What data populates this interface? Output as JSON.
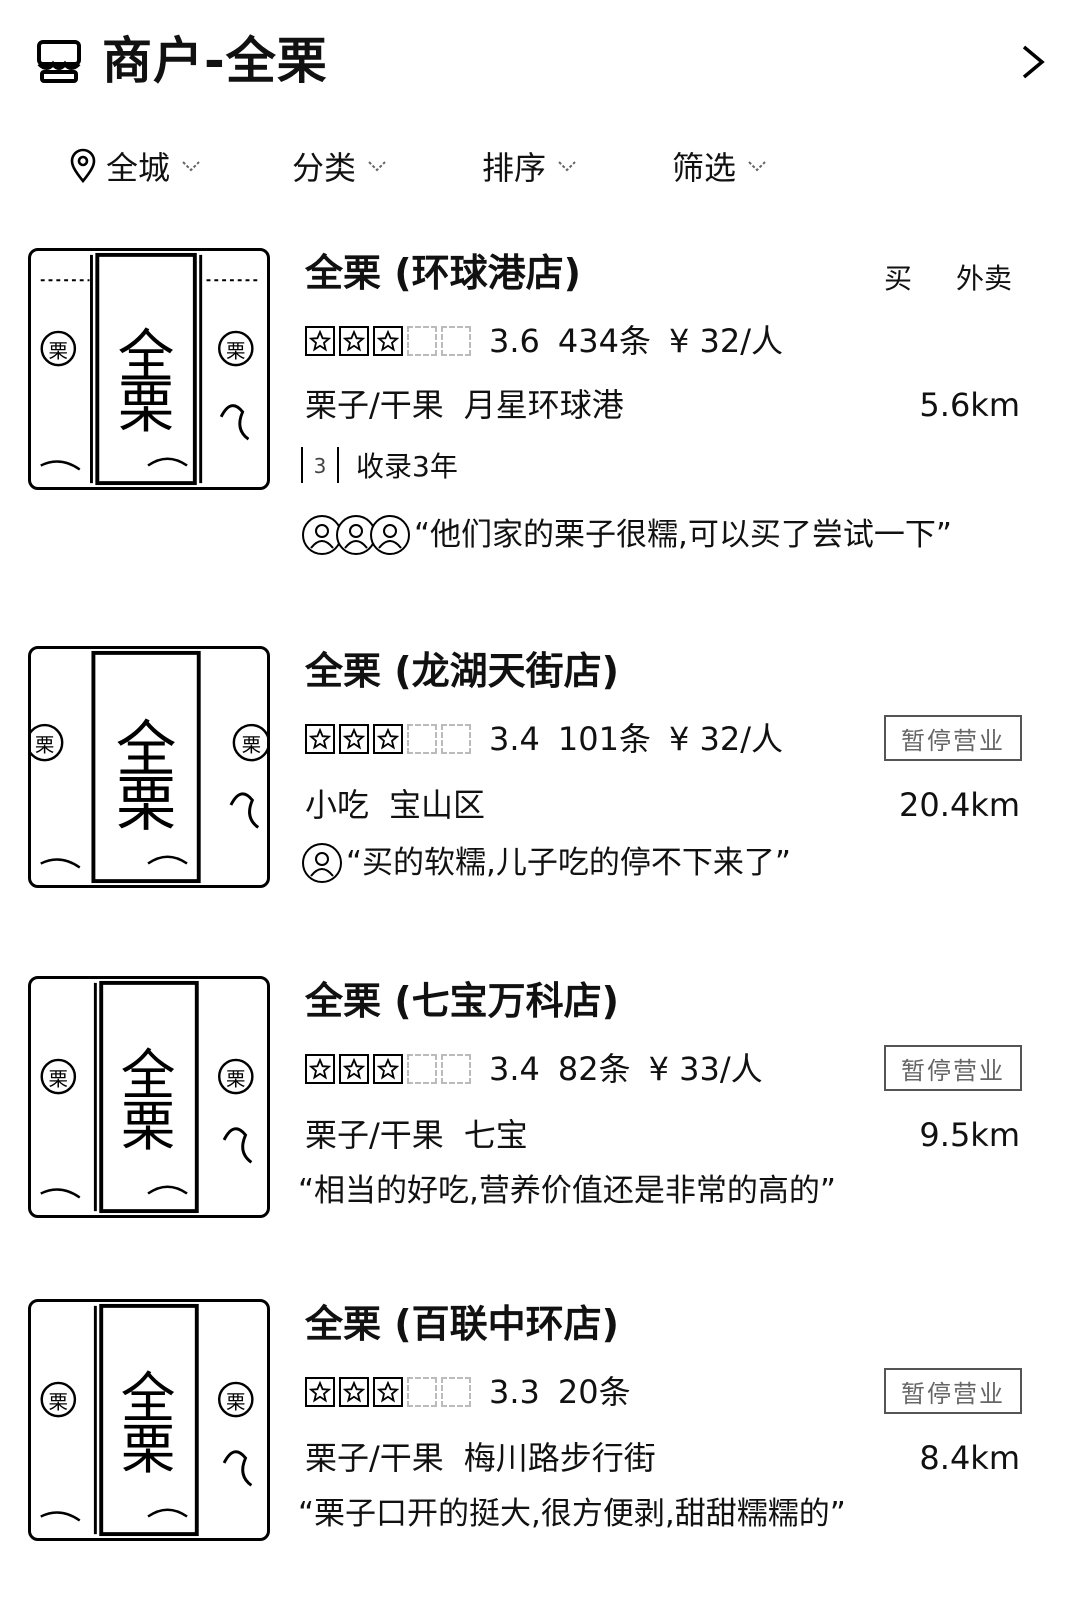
{
  "header": {
    "title": "商户-全栗",
    "icons": {
      "store": "storefront-icon",
      "forward": "chevron-right-icon"
    }
  },
  "filters": [
    {
      "label": "全城",
      "icon": "location-pin-icon"
    },
    {
      "label": "分类"
    },
    {
      "label": "排序"
    },
    {
      "label": "筛选"
    }
  ],
  "shops": [
    {
      "name": "全栗 (环球港店)",
      "rating": "3.6",
      "rating_value": 3.6,
      "reviews": "434条",
      "price": "¥ 32/人",
      "category": "栗子/干果",
      "area": "月星环球港",
      "distance": "5.6km",
      "services": [
        "买",
        "外卖"
      ],
      "record": "收录3年",
      "review": "“他们家的栗子很糯,可以买了尝试一下”",
      "reviewer_count": 3
    },
    {
      "name": "全栗 (龙湖天街店)",
      "rating": "3.4",
      "rating_value": 3.4,
      "reviews": "101条",
      "price": "¥ 32/人",
      "category": "小吃",
      "area": "宝山区",
      "distance": "20.4km",
      "status": "暂停营业",
      "review": "“买的软糯,儿子吃的停不下来了”",
      "reviewer_count": 1
    },
    {
      "name": "全栗 (七宝万科店)",
      "rating": "3.4",
      "rating_value": 3.4,
      "reviews": "82条",
      "price": "¥ 33/人",
      "category": "栗子/干果",
      "area": "七宝",
      "distance": "9.5km",
      "status": "暂停营业",
      "review": "“相当的好吃,营养价值还是非常的高的”",
      "reviewer_count": 0
    },
    {
      "name": "全栗 (百联中环店)",
      "rating": "3.3",
      "rating_value": 3.3,
      "reviews": "20条",
      "price": "",
      "category": "栗子/干果",
      "area": "梅川路步行街",
      "distance": "8.4km",
      "status": "暂停营业",
      "review": "“栗子口开的挺大,很方便剥,甜甜糯糯的”",
      "reviewer_count": 0
    }
  ],
  "thumbnail": {
    "main_text": "全栗",
    "seal_text": "栗"
  }
}
